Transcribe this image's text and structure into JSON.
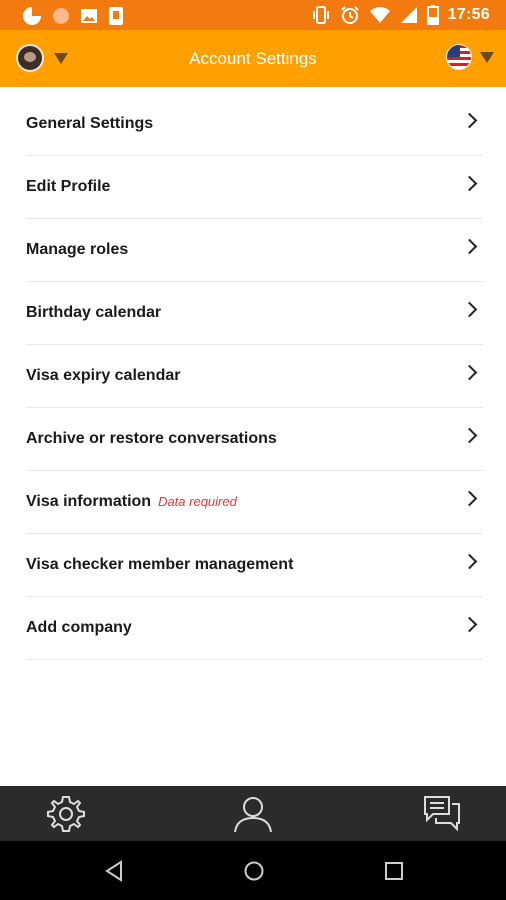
{
  "status_bar": {
    "time": "17:56",
    "icons_left": [
      "pie-icon",
      "circle-icon",
      "image-icon",
      "sd-icon"
    ],
    "icons_right": [
      "vibrate-icon",
      "alarm-icon",
      "wifi-icon",
      "signal-icon",
      "battery-icon"
    ],
    "color": "#F27A0E"
  },
  "header": {
    "title": "Account Settings",
    "color": "#FFA000"
  },
  "menu": {
    "items": [
      {
        "label": "General Settings"
      },
      {
        "label": "Edit Profile"
      },
      {
        "label": "Manage roles"
      },
      {
        "label": "Birthday calendar"
      },
      {
        "label": "Visa expiry calendar"
      },
      {
        "label": "Archive or restore conversations"
      },
      {
        "label": "Visa information",
        "note": "Data required"
      },
      {
        "label": "Visa checker member management"
      },
      {
        "label": "Add company"
      }
    ]
  },
  "bottom_tabs": [
    "gear-icon",
    "user-icon",
    "chat-icon"
  ],
  "nav_bar": [
    "back-icon",
    "home-icon",
    "recents-icon"
  ]
}
